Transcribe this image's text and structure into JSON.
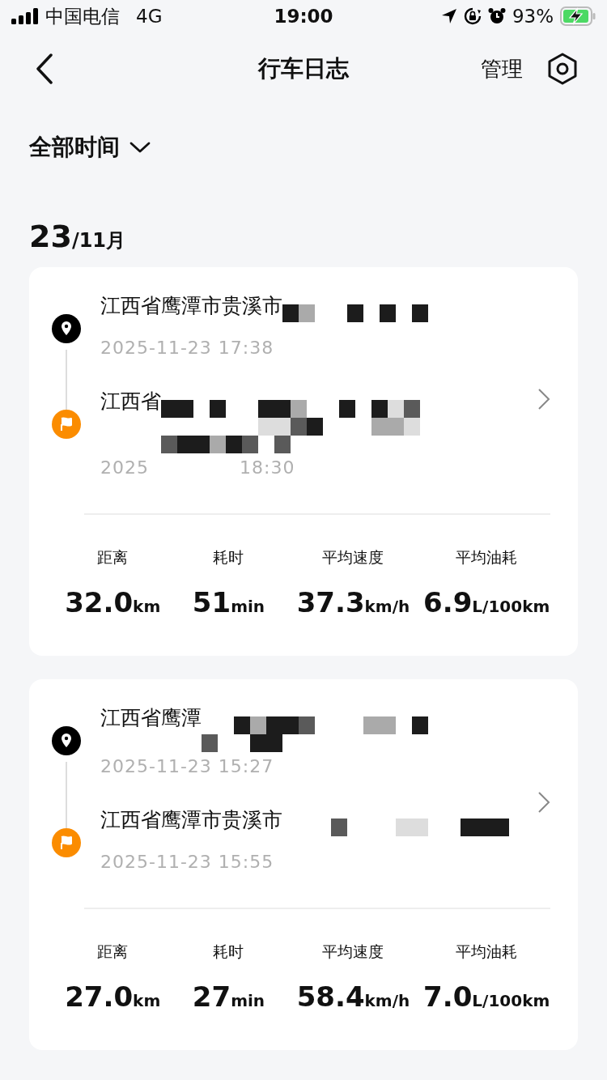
{
  "status_bar": {
    "carrier": "中国电信",
    "network": "4G",
    "time": "19:00",
    "battery": "93%"
  },
  "nav": {
    "title": "行车日志",
    "action": "管理"
  },
  "filter": {
    "label": "全部时间"
  },
  "date_group": {
    "day": "23",
    "month": "/11月"
  },
  "trips": [
    {
      "points": [
        {
          "kind": "start",
          "address": "江西省鹰潭市贵溪市",
          "time_parts": [
            "2025-11-23 17:38"
          ]
        },
        {
          "kind": "end",
          "address": "江西省",
          "time_parts": [
            "2025",
            "18:30"
          ]
        }
      ],
      "stats": [
        {
          "label": "距离",
          "value": "32.0",
          "unit": "km"
        },
        {
          "label": "耗时",
          "value": "51",
          "unit": "min"
        },
        {
          "label": "平均速度",
          "value": "37.3",
          "unit": "km/h"
        },
        {
          "label": "平均油耗",
          "value": "6.9",
          "unit": "L/100km"
        }
      ]
    },
    {
      "points": [
        {
          "kind": "start",
          "address": "江西省鹰潭",
          "time_parts": [
            "2025-11-23 15:27"
          ]
        },
        {
          "kind": "end",
          "address": "江西省鹰潭市贵溪市",
          "time_parts": [
            "2025-11-23 15:55"
          ]
        }
      ],
      "stats": [
        {
          "label": "距离",
          "value": "27.0",
          "unit": "km"
        },
        {
          "label": "耗时",
          "value": "27",
          "unit": "min"
        },
        {
          "label": "平均速度",
          "value": "58.4",
          "unit": "km/h"
        },
        {
          "label": "平均油耗",
          "value": "7.0",
          "unit": "L/100km"
        }
      ]
    }
  ]
}
